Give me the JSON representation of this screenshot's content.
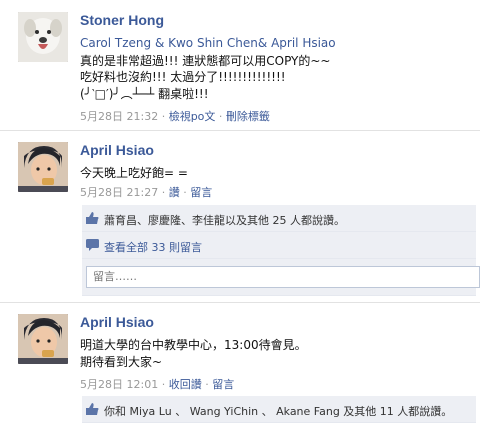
{
  "posts": [
    {
      "author": "Stoner Hong",
      "tags": "Carol Tzeng & Kwo Shin Chen& April Hsiao",
      "lines": [
        "真的是非常超過!!! 連狀態都可以用COPY的~~",
        "吃好料也沒約!!! 太過分了!!!!!!!!!!!!!!",
        "(╯‵□′)╯︵┴─┴ 翻桌啦!!!"
      ],
      "date": "5月28日 21:32",
      "sep": "·",
      "actions": [
        "檢視po文",
        "刪除標籤"
      ]
    },
    {
      "author": "April Hsiao",
      "lines": [
        "今天晚上吃好飽= ="
      ],
      "date": "5月28日 21:27",
      "sep": "·",
      "actions": [
        "讚",
        "留言"
      ],
      "likes": "蕭育昌、廖慶隆、李佳龍以及其他 25 人都說讚。",
      "view_comments": "查看全部 33 則留言",
      "comment_placeholder": "留言……"
    },
    {
      "author": "April Hsiao",
      "lines": [
        "明道大學的台中教學中心，13:00待會見。",
        "期待看到大家~"
      ],
      "date": "5月28日 12:01",
      "sep": "·",
      "actions": [
        "收回讚",
        "留言"
      ],
      "likes": "你和 Miya Lu 、 Wang YiChin 、 Akane Fang 及其他 11 人都說讚。"
    }
  ],
  "icons": {
    "like": "thumbs-up-icon",
    "comments": "comment-bubble-icon"
  },
  "colors": {
    "link": "#3b5998",
    "meta": "#999999",
    "ufi_bg": "#edeff4"
  }
}
